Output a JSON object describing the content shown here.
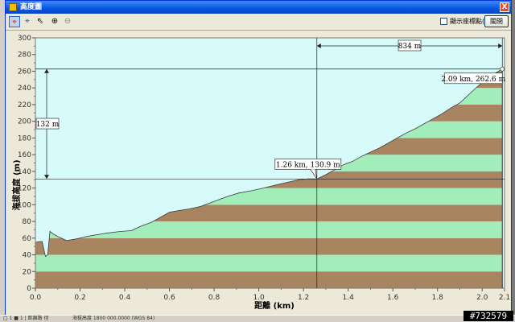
{
  "window": {
    "title": "高度圖",
    "close_glyph": "X"
  },
  "toolbar": {
    "tools": [
      {
        "name": "crosshair-red-icon",
        "glyph": "⌖",
        "color": "#d21e1e"
      },
      {
        "name": "crosshair-blue-icon",
        "glyph": "⌖",
        "color": "#1e3cd2"
      },
      {
        "name": "select-arrow-icon",
        "glyph": "⇖",
        "color": "#000"
      },
      {
        "name": "zoom-in-icon",
        "glyph": "⊕",
        "color": "#000"
      },
      {
        "name": "zoom-out-icon",
        "glyph": "⊖",
        "color": "#888"
      }
    ],
    "checkbox_label": "顯示座標點(S)",
    "close_button": "關閉"
  },
  "chart_data": {
    "type": "area",
    "xlabel": "距離 (km)",
    "ylabel": "海拔高度 (m)",
    "xlim": [
      0,
      2.1
    ],
    "ylim": [
      0,
      300
    ],
    "x_ticks": [
      "0.0",
      "0.2",
      "0.4",
      "0.6",
      "0.8",
      "1.0",
      "1.2",
      "1.4",
      "1.6",
      "1.8",
      "2.0",
      "2.1"
    ],
    "y_ticks": [
      "0",
      "20",
      "40",
      "60",
      "80",
      "100",
      "120",
      "140",
      "160",
      "180",
      "200",
      "220",
      "240",
      "260",
      "280",
      "300"
    ],
    "band_colors": [
      "#a98461",
      "#a3edbb"
    ],
    "sky_color": "#d7fbfb",
    "profile": {
      "x": [
        0.0,
        0.03,
        0.045,
        0.055,
        0.065,
        0.08,
        0.1,
        0.14,
        0.18,
        0.25,
        0.32,
        0.38,
        0.43,
        0.47,
        0.52,
        0.56,
        0.6,
        0.64,
        0.69,
        0.74,
        0.78,
        0.82,
        0.86,
        0.91,
        0.97,
        1.02,
        1.08,
        1.13,
        1.18,
        1.22,
        1.26,
        1.3,
        1.34,
        1.38,
        1.42,
        1.46,
        1.5,
        1.54,
        1.58,
        1.62,
        1.66,
        1.7,
        1.74,
        1.78,
        1.82,
        1.86,
        1.9,
        1.94,
        1.98,
        2.02,
        2.06,
        2.09
      ],
      "y": [
        55,
        56,
        38,
        40,
        68,
        65,
        62,
        57,
        59,
        63,
        66,
        68,
        69,
        74,
        79,
        85,
        91,
        93,
        95,
        98,
        102,
        106,
        110,
        114,
        117,
        120,
        124,
        127,
        130,
        131,
        130.9,
        136,
        142,
        148,
        152,
        158,
        163,
        168,
        174,
        180,
        186,
        191,
        197,
        203,
        209,
        216,
        222,
        232,
        242,
        250,
        258,
        262.6
      ]
    },
    "annotations": {
      "point_a": {
        "x": 1.26,
        "y": 130.9,
        "label": "1.26 km, 130.9 m"
      },
      "point_b": {
        "x": 2.09,
        "y": 262.6,
        "label": "2.09 km, 262.6 m"
      },
      "dist_label": "834 m",
      "height_label": "132 m"
    }
  },
  "status": {
    "left": "□ 1 ■ 1 | 距離路 徑",
    "mid": "海拔高度 1800 000.0000 (WGS 84)"
  },
  "watermark": "#732579"
}
